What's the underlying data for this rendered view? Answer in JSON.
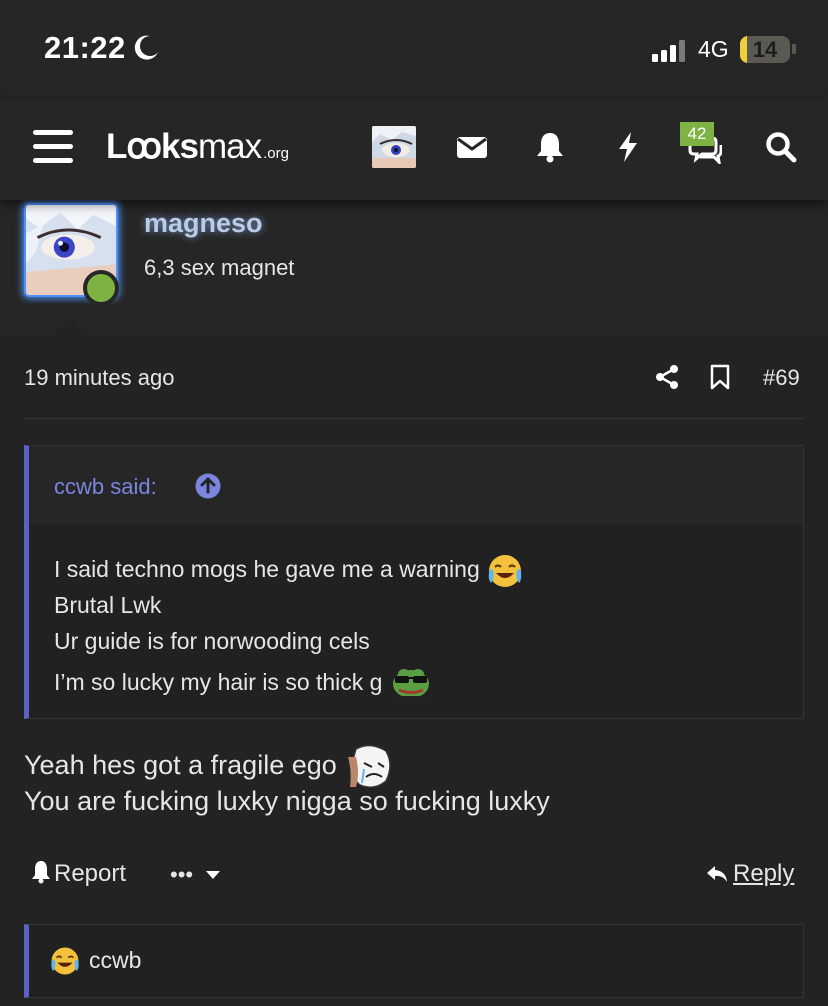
{
  "status_bar": {
    "time": "21:22",
    "network": "4G",
    "battery": "14",
    "battery_level": 0.14
  },
  "navbar": {
    "logo_main": "Lꝏks",
    "logo_max": "max",
    "logo_suffix": ".org",
    "messages_badge": "42",
    "icons": [
      "menu-icon",
      "avatar",
      "mail-icon",
      "bell-icon",
      "bolt-icon",
      "chat-icon",
      "search-icon"
    ]
  },
  "user": {
    "name": "magneso",
    "title": "6,3 sex magnet",
    "online": true,
    "name_color": "#b9cbe6"
  },
  "post": {
    "time": "19 minutes ago",
    "number": "#69",
    "quote": {
      "author": "ccwb said:",
      "lines": [
        "I said techno mogs he gave me a warning",
        "Brutal Lwk",
        "Ur guide is for norwooding cels",
        "I’m so lucky my hair is so thick g"
      ]
    },
    "body": [
      "Yeah hes got a fragile ego",
      "You are fucking luxky nigga so fucking luxky"
    ]
  },
  "actions": {
    "report": "Report",
    "more": "•••",
    "reply": "Reply"
  },
  "reactions": {
    "user": "ccwb"
  },
  "colors": {
    "accent": "#5b61c6",
    "online": "#7cb342",
    "quote_link": "#7b85e0"
  }
}
